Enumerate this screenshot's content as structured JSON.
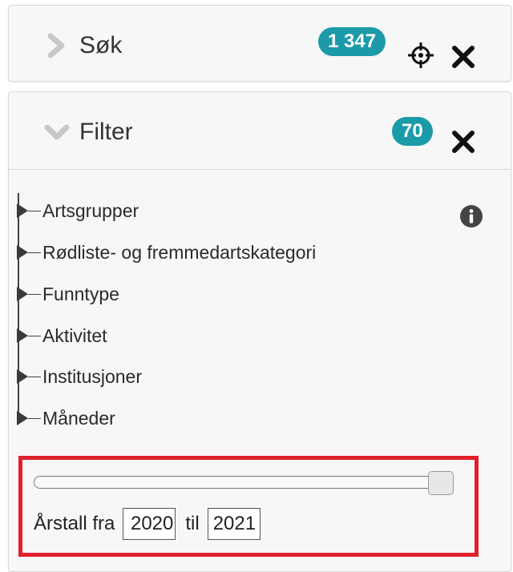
{
  "search": {
    "title": "Søk",
    "count": "1 347",
    "icons": {
      "expand": "chevron-right-icon",
      "locate": "crosshair-icon",
      "close": "close-icon"
    }
  },
  "filter": {
    "title": "Filter",
    "count": "70",
    "icons": {
      "expand": "chevron-down-icon",
      "close": "close-icon",
      "info": "info-icon",
      "item": "triangle-right-icon"
    },
    "items": [
      {
        "label": "Artsgrupper"
      },
      {
        "label": "Rødliste- og fremmedartskategori"
      },
      {
        "label": "Funntype"
      },
      {
        "label": "Aktivitet"
      },
      {
        "label": "Institusjoner"
      },
      {
        "label": "Måneder"
      }
    ],
    "year": {
      "label_from": "Årstall fra",
      "from": "2020",
      "label_to": "til",
      "to": "2021",
      "slider_position": 1.0
    }
  },
  "colors": {
    "badge": "#1b9aa8",
    "highlight_border": "#e0202a",
    "panel_bg": "#f7f7f7"
  }
}
